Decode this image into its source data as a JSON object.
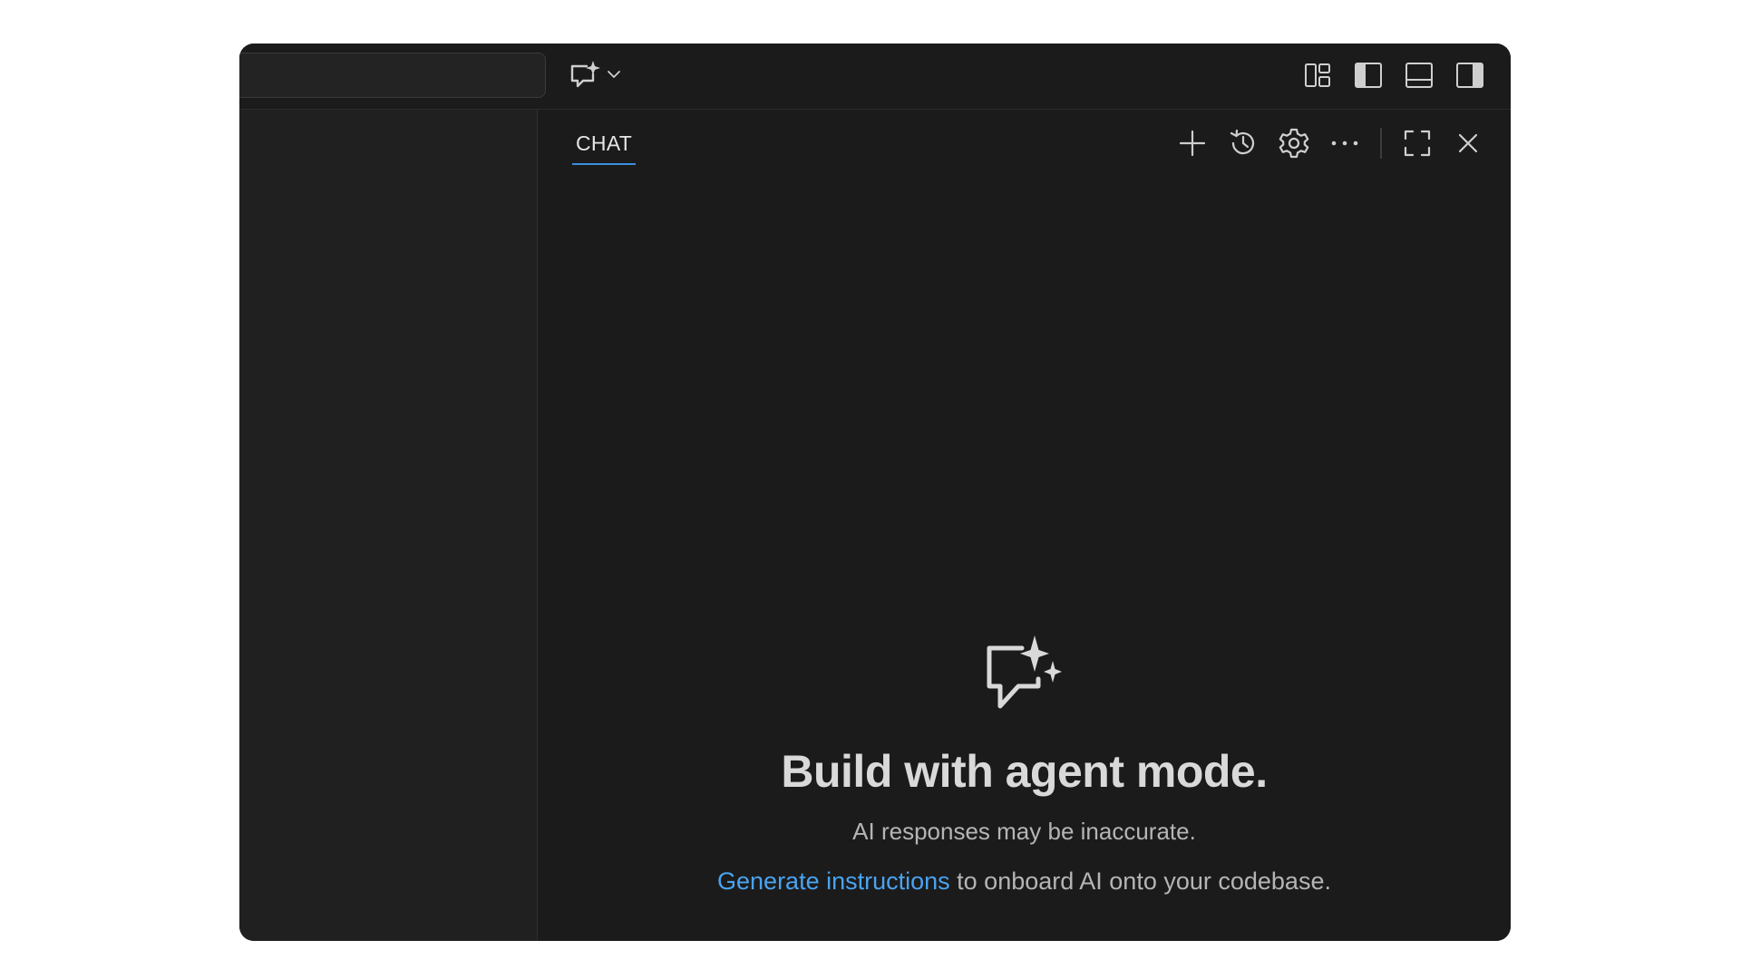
{
  "titlebar": {
    "search": {
      "value": ""
    },
    "copilot_menu": {
      "icon": "copilot-chat-sparkle-icon",
      "dropdown_icon": "chevron-down-icon"
    },
    "layout_controls": [
      {
        "name": "customize-layout",
        "icon": "layout-grid-icon"
      },
      {
        "name": "toggle-primary-sidebar",
        "icon": "sidebar-left-icon"
      },
      {
        "name": "toggle-panel",
        "icon": "panel-bottom-icon"
      },
      {
        "name": "toggle-secondary-sidebar",
        "icon": "sidebar-right-icon"
      }
    ]
  },
  "chat": {
    "tab_label": "CHAT",
    "actions": [
      {
        "name": "new-chat",
        "icon": "plus-icon"
      },
      {
        "name": "history",
        "icon": "history-icon"
      },
      {
        "name": "settings",
        "icon": "gear-icon"
      },
      {
        "name": "more",
        "icon": "ellipsis-icon"
      },
      {
        "name": "maximize",
        "icon": "maximize-icon"
      },
      {
        "name": "close",
        "icon": "close-icon"
      }
    ],
    "welcome": {
      "icon": "chat-sparkle-icon",
      "title": "Build with agent mode.",
      "subtitle": "AI responses may be inaccurate.",
      "instructions_link": "Generate instructions",
      "instructions_rest": " to onboard AI onto your codebase."
    }
  },
  "colors": {
    "window_bg": "#1b1b1b",
    "sidebar_bg": "#202020",
    "accent": "#3b8ee0",
    "link": "#4aa3f0",
    "text_primary": "#d9d9d9",
    "text_secondary": "#b5b5b5"
  }
}
